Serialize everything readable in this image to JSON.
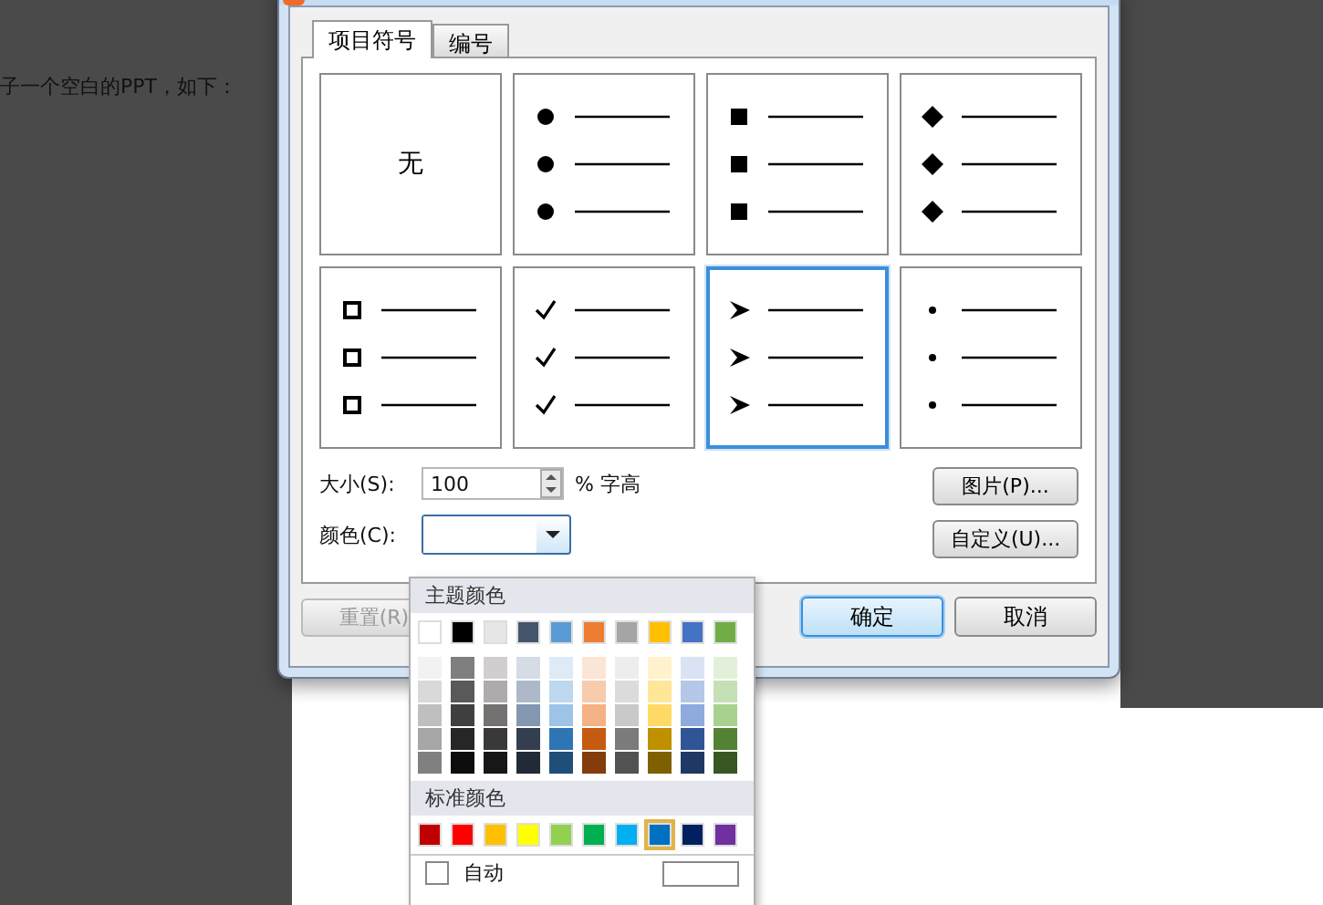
{
  "background": {
    "text": "子一个空白的PPT，如下："
  },
  "dialog": {
    "tabs": [
      {
        "label": "项目符号",
        "selected": true
      },
      {
        "label": "编号",
        "selected": false
      }
    ],
    "bullets": [
      {
        "kind": "none",
        "label": "无",
        "selected": false
      },
      {
        "kind": "dot",
        "selected": false
      },
      {
        "kind": "square",
        "selected": false
      },
      {
        "kind": "diamond",
        "selected": false
      },
      {
        "kind": "hollow-square",
        "selected": false
      },
      {
        "kind": "check",
        "selected": false
      },
      {
        "kind": "arrow",
        "selected": true
      },
      {
        "kind": "small-dot",
        "selected": false
      }
    ],
    "size": {
      "label": "大小(S):",
      "value": "100",
      "unit": "% 字高"
    },
    "color": {
      "label": "颜色(C):"
    },
    "side_buttons": [
      "图片(P)...",
      "自定义(U)..."
    ],
    "reset": {
      "label": "重置(R)",
      "disabled": true
    },
    "buttons": [
      {
        "label": "确定",
        "default": true
      },
      {
        "label": "取消",
        "default": false
      }
    ]
  },
  "color_menu": {
    "theme_title": "主题颜色",
    "theme_colors": [
      {
        "color": "#ffffff",
        "shades": [
          {
            "color": "#f2f2f2"
          },
          {
            "color": "#d9d9d9"
          },
          {
            "color": "#bfbfbf"
          },
          {
            "color": "#a6a6a6"
          },
          {
            "color": "#808080"
          }
        ]
      },
      {
        "color": "#000000",
        "shades": [
          {
            "color": "#7f7f7f"
          },
          {
            "color": "#595959"
          },
          {
            "color": "#404040"
          },
          {
            "color": "#262626"
          },
          {
            "color": "#0d0d0d"
          }
        ]
      },
      {
        "color": "#e7e6e6",
        "shades": [
          {
            "color": "#d0cece"
          },
          {
            "color": "#afabab"
          },
          {
            "color": "#767171"
          },
          {
            "color": "#3b3838"
          },
          {
            "color": "#181717"
          }
        ]
      },
      {
        "color": "#44546a",
        "shades": [
          {
            "color": "#d6dce5"
          },
          {
            "color": "#adb9ca"
          },
          {
            "color": "#8497b0"
          },
          {
            "color": "#333f50"
          },
          {
            "color": "#222a35"
          }
        ]
      },
      {
        "color": "#5b9bd5",
        "shades": [
          {
            "color": "#deebf7"
          },
          {
            "color": "#bdd7ee"
          },
          {
            "color": "#9dc3e6"
          },
          {
            "color": "#2e75b6"
          },
          {
            "color": "#1f4e79"
          }
        ]
      },
      {
        "color": "#ed7d31",
        "shades": [
          {
            "color": "#fbe5d6"
          },
          {
            "color": "#f8cbad"
          },
          {
            "color": "#f4b183"
          },
          {
            "color": "#c55a11"
          },
          {
            "color": "#843c0c"
          }
        ]
      },
      {
        "color": "#a5a5a5",
        "shades": [
          {
            "color": "#ededed"
          },
          {
            "color": "#dbdbdb"
          },
          {
            "color": "#c9c9c9"
          },
          {
            "color": "#7b7b7b"
          },
          {
            "color": "#525252"
          }
        ]
      },
      {
        "color": "#ffc000",
        "shades": [
          {
            "color": "#fff2cc"
          },
          {
            "color": "#ffe699"
          },
          {
            "color": "#ffd966"
          },
          {
            "color": "#bf9000"
          },
          {
            "color": "#7f6000"
          }
        ]
      },
      {
        "color": "#4472c4",
        "shades": [
          {
            "color": "#dae3f3"
          },
          {
            "color": "#b4c7e7"
          },
          {
            "color": "#8faadc"
          },
          {
            "color": "#2f5597"
          },
          {
            "color": "#203864"
          }
        ]
      },
      {
        "color": "#70ad47",
        "shades": [
          {
            "color": "#e2f0d9"
          },
          {
            "color": "#c5e0b4"
          },
          {
            "color": "#a9d18e"
          },
          {
            "color": "#548235"
          },
          {
            "color": "#385723"
          }
        ]
      }
    ],
    "standard_title": "标准颜色",
    "standard_colors": [
      {
        "color": "#c00000",
        "selected": false
      },
      {
        "color": "#ff0000",
        "selected": false
      },
      {
        "color": "#ffc000",
        "selected": false
      },
      {
        "color": "#ffff00",
        "selected": false
      },
      {
        "color": "#92d050",
        "selected": false
      },
      {
        "color": "#00b050",
        "selected": false
      },
      {
        "color": "#00b0f0",
        "selected": false
      },
      {
        "color": "#0070c0",
        "selected": true
      },
      {
        "color": "#002060",
        "selected": false
      },
      {
        "color": "#7030a0",
        "selected": false
      }
    ],
    "auto": {
      "label": "自动",
      "checked": false
    }
  }
}
